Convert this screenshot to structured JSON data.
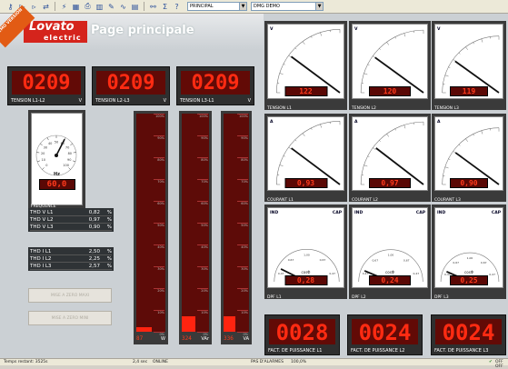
{
  "toolbar": {
    "icons": [
      "key-icon",
      "play-icon",
      "step-icon",
      "rewind-icon",
      "plug-icon",
      "grid-icon",
      "print-icon",
      "chart-icon",
      "edit-icon",
      "wave-icon",
      "calc-icon",
      "binoculars-icon",
      "sigma-icon",
      "help-icon"
    ],
    "page_select": "PRINCIPAL",
    "device_select": "DMG DEMO"
  },
  "banner": {
    "demo_badge": "DEMO VERSION",
    "logo_top": "Lovato",
    "logo_bottom": "electric",
    "title": "Page principale"
  },
  "voltage_leds": [
    {
      "value": "0209",
      "label": "TENSION L1-L2",
      "unit": "V"
    },
    {
      "value": "0209",
      "label": "TENSION L2-L3",
      "unit": "V"
    },
    {
      "value": "0209",
      "label": "TENSION L3-L1",
      "unit": "V"
    }
  ],
  "frequency": {
    "label": "FRÉQUENCE",
    "unit": "Hz",
    "value": "60,0",
    "reading": 60.0,
    "scale": [
      "0",
      "10",
      "20",
      "30",
      "40",
      "50",
      "60",
      "70",
      "80",
      "90",
      "100"
    ]
  },
  "voltage_meters": [
    {
      "label": "TENSION L1",
      "corner": "V",
      "value": "122",
      "reading": 122
    },
    {
      "label": "TENSION L2",
      "corner": "V",
      "value": "120",
      "reading": 120
    },
    {
      "label": "TENSION L3",
      "corner": "V",
      "value": "119",
      "reading": 119
    }
  ],
  "current_meters": [
    {
      "label": "COURANT L1",
      "corner": "A",
      "value": "0,93",
      "reading": 0.93
    },
    {
      "label": "COURANT L2",
      "corner": "A",
      "value": "0,97",
      "reading": 0.97
    },
    {
      "label": "COURANT L3",
      "corner": "A",
      "value": "0,90",
      "reading": 0.9
    }
  ],
  "pf_meters": [
    {
      "label": "DPF L1",
      "left": "IND",
      "right": "CAP",
      "unit": "cosΦ",
      "value": "0,28",
      "reading": 0.28
    },
    {
      "label": "DPF L2",
      "left": "IND",
      "right": "CAP",
      "unit": "cosΦ",
      "value": "0,24",
      "reading": 0.24
    },
    {
      "label": "DPF L3",
      "left": "IND",
      "right": "CAP",
      "unit": "cosΦ",
      "value": "0,25",
      "reading": 0.25
    }
  ],
  "pf_leds": [
    {
      "value": "0028",
      "label": "FACT. DE PUISSANCE L1"
    },
    {
      "value": "0024",
      "label": "FACT. DE PUISSANCE L2"
    },
    {
      "value": "0024",
      "label": "FACT. DE PUISSANCE L3"
    }
  ],
  "thd_v": [
    {
      "name": "THD V L1",
      "value": "0,82",
      "unit": "%"
    },
    {
      "name": "THD V L2",
      "value": "0,97",
      "unit": "%"
    },
    {
      "name": "THD V L3",
      "value": "0,90",
      "unit": "%"
    }
  ],
  "thd_i": [
    {
      "name": "THD I L1",
      "value": "2,50",
      "unit": "%"
    },
    {
      "name": "THD I L2",
      "value": "2,25",
      "unit": "%"
    },
    {
      "name": "THD I L3",
      "value": "2,57",
      "unit": "%"
    }
  ],
  "buttons": {
    "reset_max": "MISE A ZERO MAXI",
    "reset_min": "MISE A ZERO MINI"
  },
  "bars": [
    {
      "value": "87",
      "unit": "W",
      "percent": 2
    },
    {
      "value": "324",
      "unit": "VAr",
      "percent": 7
    },
    {
      "value": "336",
      "unit": "VA",
      "percent": 7
    }
  ],
  "bar_scale": [
    "100%",
    "90%",
    "80%",
    "70%",
    "60%",
    "50%",
    "40%",
    "30%",
    "20%",
    "10%",
    "0%"
  ],
  "status": {
    "time_left": "Temps restant: 3525s",
    "poll": "2,4 sec",
    "mode": "ONLINE",
    "alarms": "PAS D'ALARMES",
    "progress": "100,0%",
    "flags": "OFF OFF"
  }
}
